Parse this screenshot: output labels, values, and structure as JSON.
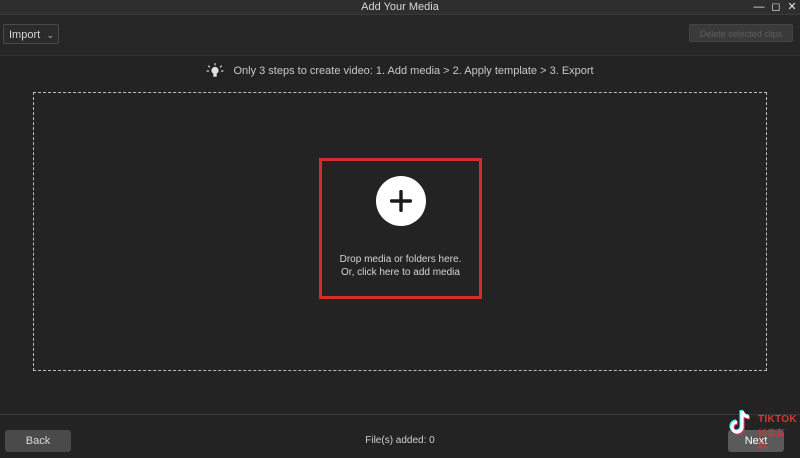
{
  "window": {
    "title": "Add Your Media",
    "controls": [
      "minimize-icon",
      "maximize-icon",
      "close-icon"
    ]
  },
  "toolbar": {
    "import_label": "Import",
    "delete_selected_label": "Delete selected clips"
  },
  "tip": {
    "icon": "lightbulb-icon",
    "text": "Only 3 steps to create video: 1. Add media > 2. Apply template > 3. Export"
  },
  "dropzone": {
    "add_icon": "plus-icon",
    "line1": "Drop media or folders here.",
    "line2": "Or, click here to add media"
  },
  "footer": {
    "back_label": "Back",
    "files_added": "File(s) added: 0",
    "next_label": "Next"
  },
  "watermark": {
    "brand": "TIKTOK",
    "subtitle": "抖音有料"
  },
  "colors": {
    "background": "#232323",
    "highlight": "#d42d2d",
    "dashed_border": "#bdbdbd"
  }
}
